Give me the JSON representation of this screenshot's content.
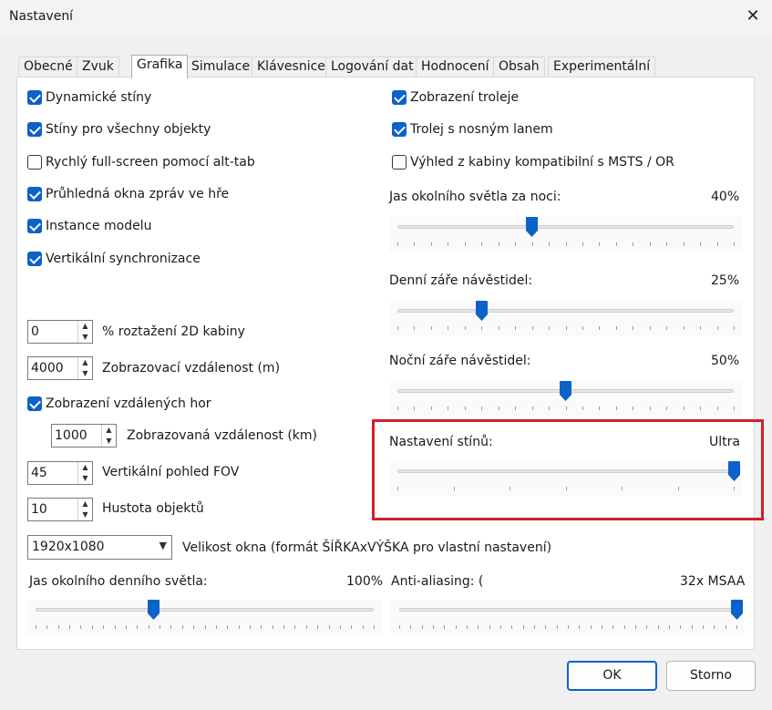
{
  "window": {
    "title": "Nastavení",
    "close_icon": "close-icon"
  },
  "tabs": [
    "Obecné",
    "Zvuk",
    "Grafika",
    "Simulace",
    "Klávesnice",
    "Logování dat",
    "Hodnocení",
    "Obsah",
    "Experimentální"
  ],
  "active_tab": "Grafika",
  "left_checkboxes": [
    {
      "label": "Dynamické stíny",
      "checked": true
    },
    {
      "label": "Stíny pro všechny objekty",
      "checked": true
    },
    {
      "label": "Rychlý full-screen pomocí alt-tab",
      "checked": false
    },
    {
      "label": "Průhledná okna zpráv ve hře",
      "checked": true
    },
    {
      "label": "Instance modelu",
      "checked": true
    },
    {
      "label": "Vertikální synchronizace",
      "checked": true
    }
  ],
  "right_checkboxes": [
    {
      "label": "Zobrazení troleje",
      "checked": true
    },
    {
      "label": "Trolej s nosným lanem",
      "checked": true
    },
    {
      "label": "Výhled z kabiny kompatibilní s MSTS / OR",
      "checked": false
    }
  ],
  "spinners": {
    "cab_stretch": {
      "value": "0",
      "label": "% roztažení 2D kabiny"
    },
    "view_distance": {
      "value": "4000",
      "label": "Zobrazovací vzdálenost (m)"
    },
    "distant_mountains_checkbox": {
      "label": "Zobrazení vzdálených hor",
      "checked": true
    },
    "mountain_distance": {
      "value": "1000",
      "label": "Zobrazovaná vzdálenost (km)"
    },
    "fov": {
      "value": "45",
      "label": "Vertikální pohled FOV"
    },
    "object_density": {
      "value": "10",
      "label": "Hustota objektů"
    }
  },
  "window_size": {
    "value": "1920x1080",
    "label": "Velikost okna (formát ŠÍŘKAxVÝŠKA pro vlastní nastavení)"
  },
  "sliders": {
    "night_ambient": {
      "label": "Jas okolního světla za noci:",
      "value_text": "40%",
      "fraction": 0.4
    },
    "day_signal_glow": {
      "label": "Denní záře návěstidel:",
      "value_text": "25%",
      "fraction": 0.25
    },
    "night_signal_glow": {
      "label": "Noční záře návěstidel:",
      "value_text": "50%",
      "fraction": 0.5
    },
    "shadow_quality": {
      "label": "Nastavení stínů:",
      "value_text": "Ultra",
      "fraction": 1.0
    },
    "day_ambient": {
      "label": "Jas okolního denního světla:",
      "value_text": "100%",
      "fraction": 0.35
    },
    "anti_aliasing": {
      "label": "Anti-aliasing: (",
      "value_text": "32x MSAA",
      "fraction": 1.0
    }
  },
  "buttons": {
    "ok": "OK",
    "cancel": "Storno"
  },
  "colors": {
    "accent": "#0b62c8",
    "highlight": "#d0202a"
  }
}
